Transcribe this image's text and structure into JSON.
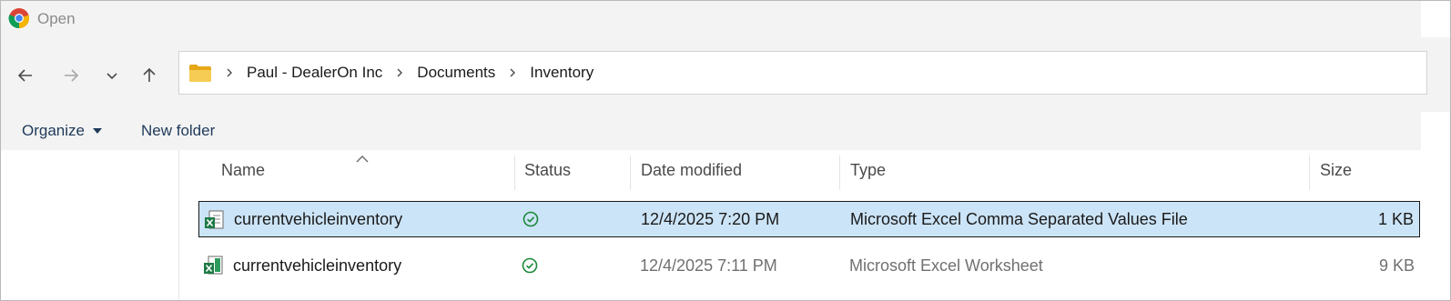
{
  "window": {
    "title": "Open",
    "app_icon": "chrome-icon"
  },
  "navigation": {
    "back_icon": "arrow-left-icon",
    "forward_icon": "arrow-right-icon",
    "recent_icon": "chevron-down-icon",
    "up_icon": "arrow-up-icon"
  },
  "address": {
    "folder_icon": "folder-icon",
    "crumbs": [
      "Paul - DealerOn Inc",
      "Documents",
      "Inventory"
    ]
  },
  "toolbar": {
    "organize_label": "Organize",
    "new_folder_label": "New folder"
  },
  "columns": {
    "name": "Name",
    "status": "Status",
    "date_modified": "Date modified",
    "type": "Type",
    "size": "Size",
    "sort_indicator": "sort-ascending-icon"
  },
  "files": [
    {
      "name": "currentvehicleinventory",
      "icon": "excel-csv-file-icon",
      "status_icon": "synced-check-icon",
      "date_modified": "12/4/2025 7:20 PM",
      "type": "Microsoft Excel Comma Separated Values File",
      "size": "1 KB",
      "selected": true
    },
    {
      "name": "currentvehicleinventory",
      "icon": "excel-worksheet-file-icon",
      "status_icon": "synced-check-icon",
      "date_modified": "12/4/2025 7:11 PM",
      "type": "Microsoft Excel Worksheet",
      "size": "9 KB",
      "selected": false
    }
  ],
  "colors": {
    "selection": "#cce4f7",
    "status_green": "#1a8a3a",
    "excel_green": "#1d7a45",
    "folder_yellow": "#f2c14e"
  }
}
